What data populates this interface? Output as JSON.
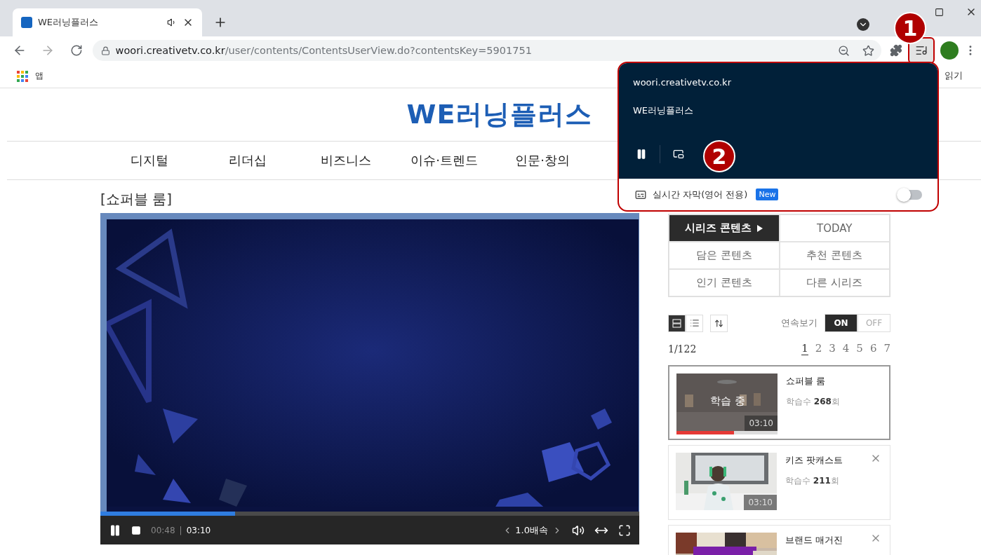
{
  "browser": {
    "tab": {
      "title": "WE러닝플러스"
    },
    "url": {
      "host": "woori.creativetv.co.kr",
      "path": "/user/contents/ContentsUserView.do?contentsKey=5901751"
    },
    "bookmarks": [
      {
        "label": "앱"
      }
    ],
    "reading_list": "읽기"
  },
  "site": {
    "logo": "WE러닝플러스"
  },
  "nav": [
    "디지털",
    "리더십",
    "비즈니스",
    "이슈·트렌드",
    "인문·창의"
  ],
  "content_title": "[쇼퍼블 룸]",
  "player": {
    "level": 0.25,
    "elapsed": "00:48",
    "separator": "|",
    "duration": "03:10",
    "speed": "1.0배속",
    "playing": true
  },
  "side_tabs": [
    {
      "label": "시리즈 콘텐츠",
      "selected": true
    },
    {
      "label": "TODAY",
      "selected": false
    },
    {
      "label": "담은 콘텐츠",
      "selected": false
    },
    {
      "label": "추천 콘텐츠",
      "selected": false
    },
    {
      "label": "인기 콘텐츠",
      "selected": false
    },
    {
      "label": "다른 시리즈",
      "selected": false
    }
  ],
  "view_modes": [
    {
      "kind": "card",
      "selected": true
    },
    {
      "kind": "list",
      "selected": false
    }
  ],
  "autoplay": {
    "label": "연속보기",
    "options": [
      {
        "label": "ON",
        "selected": true
      },
      {
        "label": "OFF",
        "selected": false
      }
    ]
  },
  "page_count": "1/122",
  "pages": [
    {
      "label": "1",
      "selected": true
    },
    {
      "label": "2",
      "selected": false
    },
    {
      "label": "3",
      "selected": false
    },
    {
      "label": "4",
      "selected": false
    },
    {
      "label": "5",
      "selected": false
    },
    {
      "label": "6",
      "selected": false
    },
    {
      "label": "7",
      "selected": false
    }
  ],
  "playlist": [
    {
      "title": "쇼퍼블 룸",
      "views": "학습수 **268**회",
      "duration": "03:10",
      "status": "학습 중",
      "level": 0.57,
      "selected": true,
      "removable": false
    },
    {
      "title": "키즈 팟캐스트",
      "views": "학습수 **211**회",
      "duration": "03:10",
      "selected": false,
      "removable": true
    },
    {
      "title": "브랜드 매거진",
      "selected": false,
      "removable": true
    }
  ],
  "media_popup": {
    "site": "woori.creativetv.co.kr",
    "title": "WE러닝플러스",
    "playing": true,
    "caption_label": "실시간 자막(영어 전용)",
    "badge": "New",
    "captions_on": false
  },
  "annotations": [
    {
      "label": "1"
    },
    {
      "label": "2"
    }
  ]
}
